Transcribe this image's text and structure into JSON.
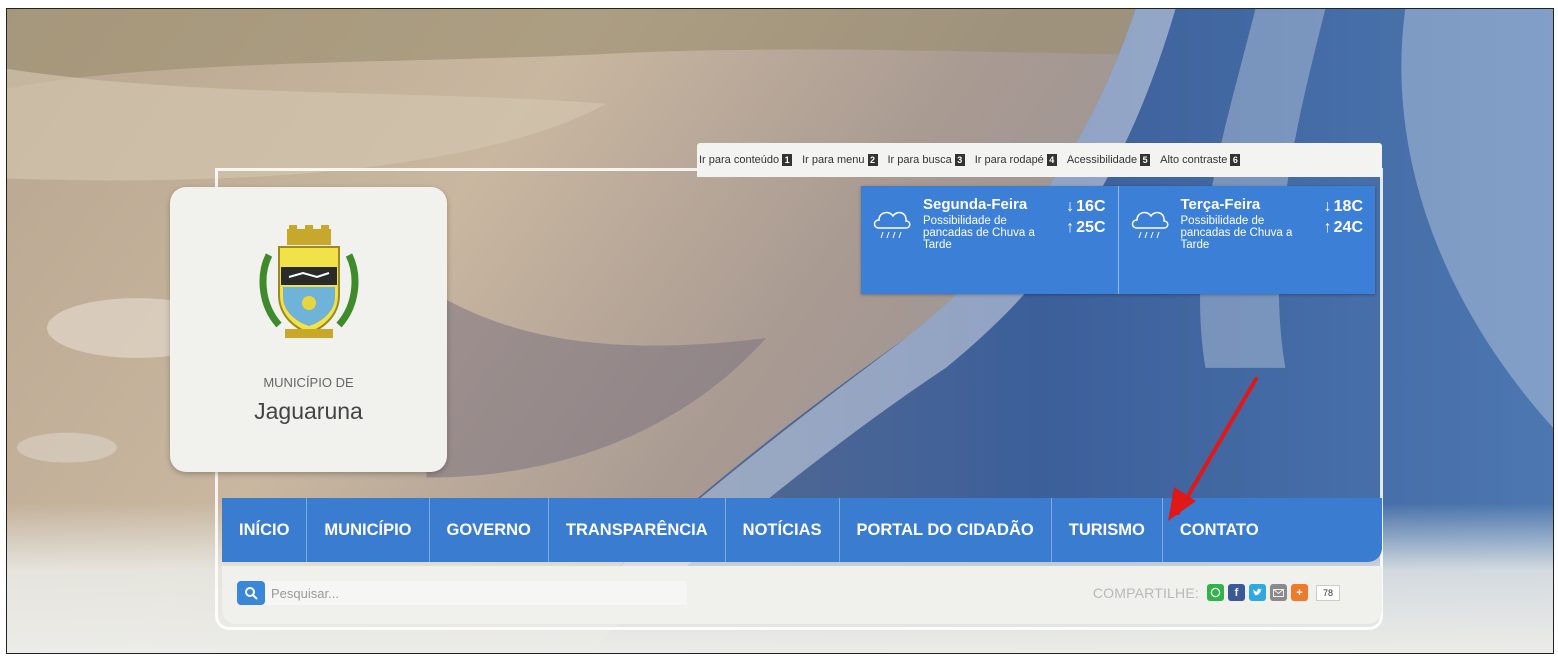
{
  "accessibility_bar": {
    "links": [
      {
        "label": "Ir para conteúdo",
        "key": "1"
      },
      {
        "label": "Ir para menu",
        "key": "2"
      },
      {
        "label": "Ir para busca",
        "key": "3"
      },
      {
        "label": "Ir para rodapé",
        "key": "4"
      },
      {
        "label": "Acessibilidade",
        "key": "5"
      },
      {
        "label": "Alto contraste",
        "key": "6"
      }
    ]
  },
  "logo": {
    "prefix": "MUNICÍPIO DE",
    "name": "Jaguaruna"
  },
  "weather": [
    {
      "day": "Segunda-Feira",
      "desc": "Possibilidade de pancadas de Chuva a Tarde",
      "min": "16C",
      "max": "25C",
      "icon": "rain-cloud-icon"
    },
    {
      "day": "Terça-Feira",
      "desc": "Possibilidade de pancadas de Chuva a Tarde",
      "min": "18C",
      "max": "24C",
      "icon": "rain-cloud-icon"
    }
  ],
  "nav": {
    "items": [
      "INÍCIO",
      "MUNICÍPIO",
      "GOVERNO",
      "TRANSPARÊNCIA",
      "NOTÍCIAS",
      "PORTAL DO CIDADÃO",
      "TURISMO",
      "CONTATO"
    ]
  },
  "search": {
    "placeholder": "Pesquisar..."
  },
  "share": {
    "label": "COMPARTILHE:",
    "count": "78",
    "buttons": [
      {
        "icon": "whatsapp-icon",
        "color": "#2fb34a"
      },
      {
        "icon": "facebook-icon",
        "color": "#3b5998"
      },
      {
        "icon": "twitter-icon",
        "color": "#2fa8e0"
      },
      {
        "icon": "email-icon",
        "color": "#8a8a8a"
      },
      {
        "icon": "plus-icon",
        "color": "#f07a2c"
      }
    ]
  },
  "colors": {
    "nav_blue": "#3a7dd0",
    "weather_blue": "#3c7fd6",
    "annotation_red": "#e01818"
  }
}
